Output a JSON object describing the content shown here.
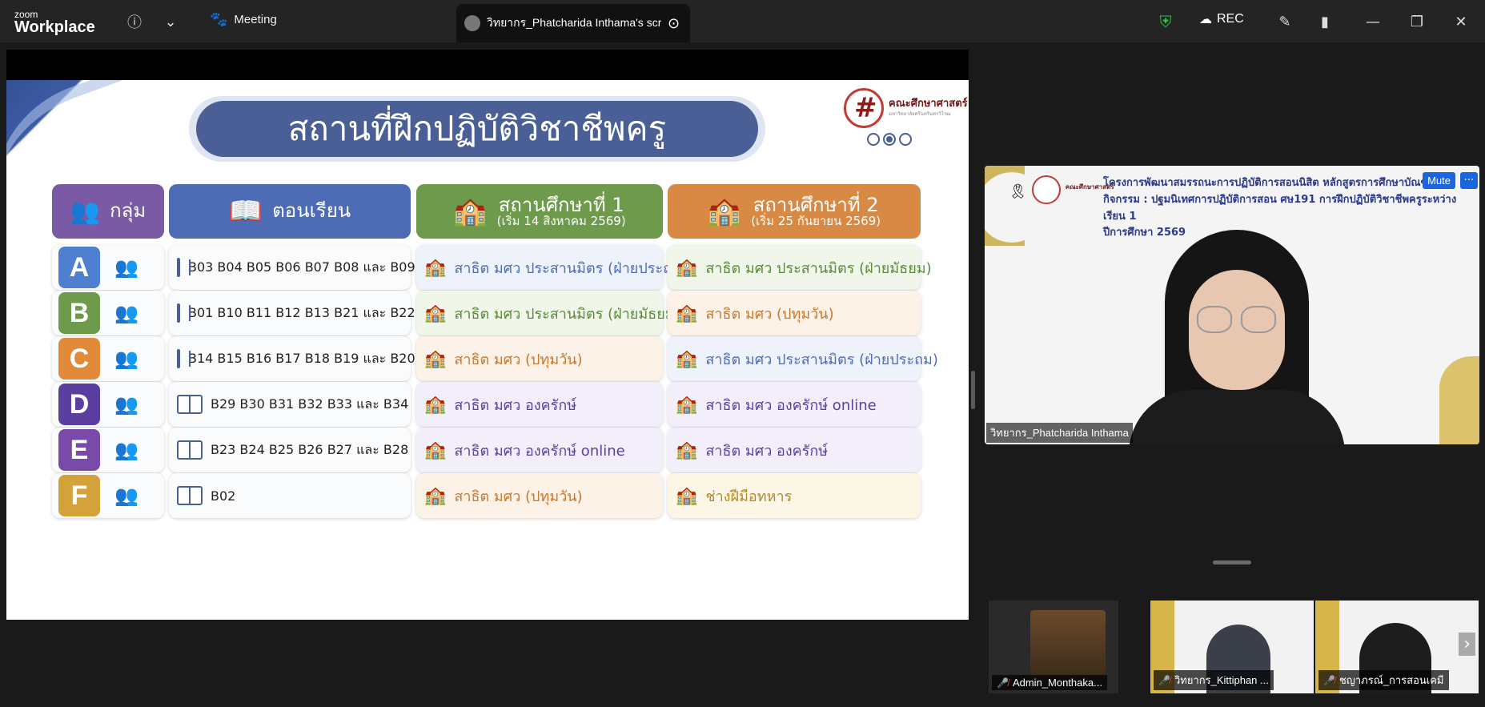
{
  "app": {
    "logo_top": "zoom",
    "logo_bottom": "Workplace",
    "meeting_label": "Meeting",
    "share_tab_title": "วิทยากร_Phatcharida Inthama's scr",
    "rec_label": "REC"
  },
  "slide": {
    "title": "สถานที่ฝึกปฏิบัติวิชาชีพครู",
    "faculty_name": "คณะศึกษาศาสตร์",
    "faculty_sub": "มหาวิทยาลัยศรีนครินทรวิโรฒ",
    "headers": {
      "group": "กลุ่ม",
      "section": "ตอนเรียน",
      "site1": "สถานศึกษาที่ 1",
      "site1_sub": "(เริ่ม 14 สิงหาคม 2569)",
      "site2": "สถานศึกษาที่ 2",
      "site2_sub": "(เริ่ม 25 กันยายน 2569)"
    },
    "rows": [
      {
        "letter": "A",
        "sections": "B03 B04 B05 B06 B07 B08 และ B09",
        "site1": "สาธิต มศว ประสานมิตร (ฝ่ายประถม)",
        "site2": "สาธิต มศว ประสานมิตร (ฝ่ายมัธยม)"
      },
      {
        "letter": "B",
        "sections": "B01 B10 B11 B12 B13 B21 และ B22",
        "site1": "สาธิต มศว ประสานมิตร (ฝ่ายมัธยม)",
        "site2": "สาธิต มศว (ปทุมวัน)"
      },
      {
        "letter": "C",
        "sections": "B14 B15 B16 B17 B18 B19 และ B20",
        "site1": "สาธิต มศว (ปทุมวัน)",
        "site2": "สาธิต มศว ประสานมิตร (ฝ่ายประถม)"
      },
      {
        "letter": "D",
        "sections": "B29 B30 B31 B32 B33 และ B34",
        "site1": "สาธิต มศว องครักษ์",
        "site2": "สาธิต มศว องครักษ์ online"
      },
      {
        "letter": "E",
        "sections": "B23 B24 B25 B26 B27 และ B28",
        "site1": "สาธิต มศว องครักษ์ online",
        "site2": "สาธิต มศว องครักษ์"
      },
      {
        "letter": "F",
        "sections": "B02",
        "site1": "สาธิต มศว (ปทุมวัน)",
        "site2": "ช่างฝีมือทหาร"
      }
    ]
  },
  "speaker": {
    "project_line1": "โครงการพัฒนาสมรรถนะการปฏิบัติการสอนนิสิต หลักสูตรการศึกษาบัณฑิต",
    "project_line2": "กิจกรรม : ปฐมนิเทศการปฏิบัติการสอน ศษ191 การฝึกปฏิบัติวิชาชีพครูระหว่างเรียน 1",
    "project_line3": "ปีการศึกษา 2569",
    "name": "วิทยากร_Phatcharida Inthama",
    "mute_label": "Mute",
    "more_label": "···"
  },
  "participants": [
    {
      "name": "Admin_Monthaka..."
    },
    {
      "name": "วิทยากร_Kittiphan ..."
    },
    {
      "name": "ชญาภรณ์_การสอนเคมี"
    }
  ]
}
